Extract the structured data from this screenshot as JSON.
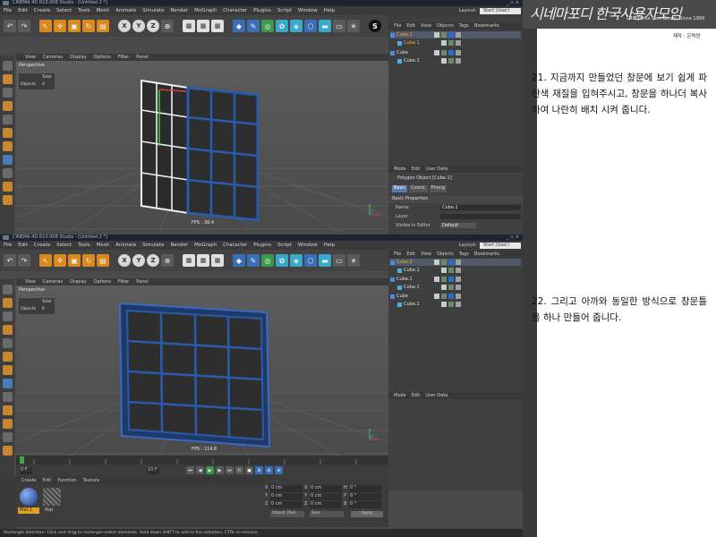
{
  "top_window": {
    "title": "CINEMA 4D R10.008 Studio - [Untitled 2 *]",
    "menu": [
      "File",
      "Edit",
      "Create",
      "Select",
      "Tools",
      "Mesh",
      "Animate",
      "Simulate",
      "Render",
      "MoGraph",
      "Character",
      "Plugins",
      "Script",
      "Window",
      "Help"
    ],
    "layout_label": "Layout:",
    "layout_value": "Start (User)",
    "viewport_menu": [
      "View",
      "Cameras",
      "Display",
      "Options",
      "Filter",
      "Panel"
    ],
    "viewport_label": "Perspective",
    "hud_total": "Total",
    "hud_objects_label": "Objects",
    "hud_objects_value": "4",
    "fps": "FPS : 38.4",
    "object_menu": [
      "File",
      "Edit",
      "View",
      "Objects",
      "Tags",
      "Bookmarks"
    ],
    "objects": [
      {
        "name": "Cube.1",
        "indent": 0
      },
      {
        "name": "Cube.1",
        "indent": 1
      },
      {
        "name": "Cube",
        "indent": 0
      },
      {
        "name": "Cube.1",
        "indent": 1
      }
    ],
    "attr_menu": [
      "Mode",
      "Edit",
      "User Data"
    ],
    "attr_object": "Polygon Object [Cube.1]",
    "attr_tabs": [
      "Basic",
      "Coord.",
      "Phong"
    ],
    "attr_section": "Basic Properties",
    "attr_name_label": "Name",
    "attr_name_value": "Cube.1",
    "attr_layer_label": "Layer",
    "attr_visible_label": "Visible in Editor",
    "attr_visible_value": "Default"
  },
  "bottom_window": {
    "title": "CINEMA 4D R10.008 Studio - [Untitled 2 *]",
    "menu": [
      "File",
      "Edit",
      "Create",
      "Select",
      "Tools",
      "Mesh",
      "Animate",
      "Simulate",
      "Render",
      "MoGraph",
      "Character",
      "Plugins",
      "Script",
      "Window",
      "Help"
    ],
    "layout_label": "Layout:",
    "layout_value": "Start (User)",
    "viewport_menu": [
      "View",
      "Cameras",
      "Display",
      "Options",
      "Filter",
      "Panel"
    ],
    "viewport_label": "Perspective",
    "hud_total": "Total",
    "hud_objects_label": "Objects",
    "hud_objects_value": "6",
    "fps": "FPS : 114.8",
    "object_menu": [
      "File",
      "Edit",
      "View",
      "Objects",
      "Tags",
      "Bookmarks"
    ],
    "objects": [
      {
        "name": "Cube.2",
        "indent": 0
      },
      {
        "name": "Cube.1",
        "indent": 1
      },
      {
        "name": "Cube.1",
        "indent": 0
      },
      {
        "name": "Cube.1",
        "indent": 1
      },
      {
        "name": "Cube",
        "indent": 0
      },
      {
        "name": "Cube.1",
        "indent": 1
      }
    ],
    "attr_menu": [
      "Mode",
      "Edit",
      "User Data"
    ],
    "frame_start": "0 F",
    "frame_end": "10 F",
    "material_menu": [
      "Create",
      "Edit",
      "Function",
      "Texture"
    ],
    "materials": [
      "Mat.1",
      "Mat"
    ],
    "coord_rows": [
      {
        "axis": "X",
        "pos": "0 cm",
        "size": "0 cm",
        "rot_axis": "H",
        "rot": "0 °"
      },
      {
        "axis": "Y",
        "pos": "0 cm",
        "size": "0 cm",
        "rot_axis": "P",
        "rot": "0 °"
      },
      {
        "axis": "Z",
        "pos": "0 cm",
        "size": "0 cm",
        "rot_axis": "B",
        "rot": "0 °"
      }
    ],
    "coord_mode": "Object (Rel)",
    "coord_size_mode": "Size",
    "apply": "Apply",
    "status": "Rectangle Selection: Click and drag to rectangle-select elements. Hold down SHIFT to add to the selection, CTRL to remove."
  },
  "logo": {
    "calligraphy": "시네마포디 한국사용자모임",
    "subtitle": "C4D Korea User Group, Since 1999"
  },
  "credit": "제작 : 은락란",
  "steps": [
    "21. 지금까지 만들었던 창문에 보기 쉽게 파란색 재질을 입혀주시고, 창문을 하나더 복사하여 나란히 배치 시켜 줍니다.",
    "22. 그리고 아까와 동일한 방식으로 창문틀을 하나 만들어 줍니다."
  ]
}
